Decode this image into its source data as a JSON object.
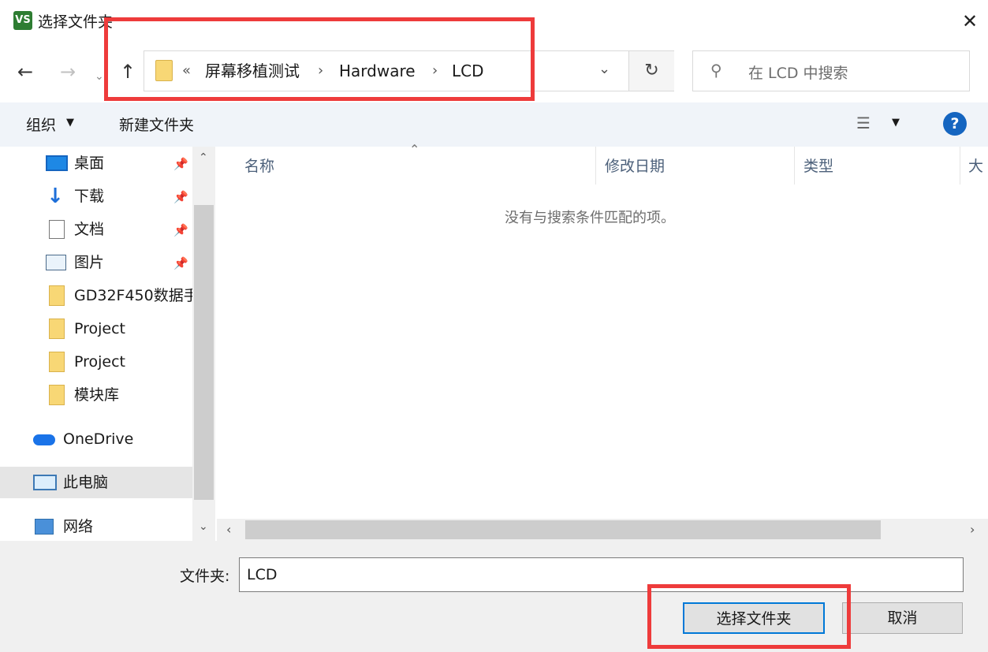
{
  "window": {
    "app_icon_text": "VS",
    "title": "选择文件夹",
    "close_glyph": "✕"
  },
  "nav": {
    "back_glyph": "←",
    "forward_glyph": "→",
    "recent_glyph": "⌄",
    "up_glyph": "↑"
  },
  "address": {
    "overflow": "«",
    "breadcrumbs": [
      "屏幕移植测试",
      "Hardware",
      "LCD"
    ],
    "separator": "›",
    "dropdown_glyph": "⌄",
    "refresh_glyph": "↻"
  },
  "search": {
    "icon_glyph": "⚲",
    "placeholder": "在 LCD 中搜索"
  },
  "toolbar": {
    "organize": "组织",
    "organize_arrow": "▼",
    "new_folder": "新建文件夹",
    "view_glyph": "☰",
    "view_arrow": "▼",
    "help_glyph": "?"
  },
  "sidebar": {
    "items": [
      {
        "label": "桌面",
        "icon": "desktop-icon",
        "pinned": true
      },
      {
        "label": "下载",
        "icon": "download-icon",
        "pinned": true
      },
      {
        "label": "文档",
        "icon": "document-icon",
        "pinned": true
      },
      {
        "label": "图片",
        "icon": "pictures-icon",
        "pinned": true
      },
      {
        "label": "GD32F450数据手",
        "icon": "folder-icon",
        "pinned": false
      },
      {
        "label": "Project",
        "icon": "folder-icon",
        "pinned": false
      },
      {
        "label": "Project",
        "icon": "folder-icon",
        "pinned": false
      },
      {
        "label": "模块库",
        "icon": "folder-icon",
        "pinned": false
      },
      {
        "label": "OneDrive",
        "icon": "onedrive-icon",
        "pinned": false
      },
      {
        "label": "此电脑",
        "icon": "this-pc-icon",
        "pinned": false,
        "selected": true
      },
      {
        "label": "网络",
        "icon": "network-icon",
        "pinned": false
      }
    ],
    "pin_glyph": "📌",
    "scroll_up": "⌃",
    "scroll_down": "⌄"
  },
  "files": {
    "columns": [
      "名称",
      "修改日期",
      "类型",
      "大"
    ],
    "sort_glyph": "⌃",
    "empty_message": "没有与搜索条件匹配的项。",
    "scroll_left": "‹",
    "scroll_right": "›"
  },
  "footer": {
    "folder_label": "文件夹:",
    "folder_value": "LCD",
    "select_button": "选择文件夹",
    "cancel_button": "取消"
  },
  "colors": {
    "highlight": "#ee3b3b",
    "accent": "#0078d7",
    "folder": "#f8d775"
  }
}
